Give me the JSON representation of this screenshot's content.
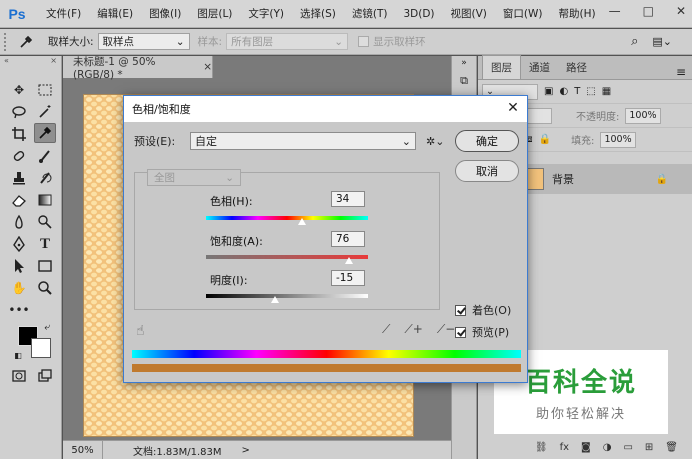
{
  "app": {
    "logo": "Ps",
    "menu": [
      "文件(F)",
      "编辑(E)",
      "图像(I)",
      "图层(L)",
      "文字(Y)",
      "选择(S)",
      "滤镜(T)",
      "3D(D)",
      "视图(V)",
      "窗口(W)",
      "帮助(H)"
    ],
    "window_controls": [
      "—",
      "□",
      "✕"
    ]
  },
  "options_bar": {
    "sample_size_label": "取样大小:",
    "sample_size_value": "取样点",
    "sample_label": "样本:",
    "sample_value": "所有图层",
    "show_ring_label": "显示取样环"
  },
  "document": {
    "tab_title": "未标题-1 @ 50%(RGB/8) *",
    "tab_close": "×",
    "zoom": "50%",
    "doc_info": "文档:1.83M/1.83M",
    "status_arrow": ">"
  },
  "layers_panel": {
    "tabs": [
      "图层",
      "通道",
      "路径"
    ],
    "opacity_label": "不透明度:",
    "opacity_value": "100%",
    "fill_label": "填充:",
    "fill_value": "100%",
    "layer_name": "背景"
  },
  "dialog": {
    "title": "色相/饱和度",
    "preset_label": "预设(E):",
    "preset_value": "自定",
    "ok_label": "确定",
    "cancel_label": "取消",
    "channel_value": "全图",
    "hue_label": "色相(H):",
    "hue_value": "34",
    "saturation_label": "饱和度(A):",
    "saturation_value": "76",
    "lightness_label": "明度(I):",
    "lightness_value": "-15",
    "colorize_label": "着色(O)",
    "colorize_checked": true,
    "preview_label": "预览(P)",
    "preview_checked": true,
    "hue_slider": {
      "min": -180,
      "max": 180,
      "value": 34
    },
    "saturation_slider": {
      "min": -100,
      "max": 100,
      "value": 76
    },
    "lightness_slider": {
      "min": -100,
      "max": 100,
      "value": -15
    }
  },
  "watermark": {
    "main": "百科全说",
    "sub": "助你轻松解决"
  }
}
